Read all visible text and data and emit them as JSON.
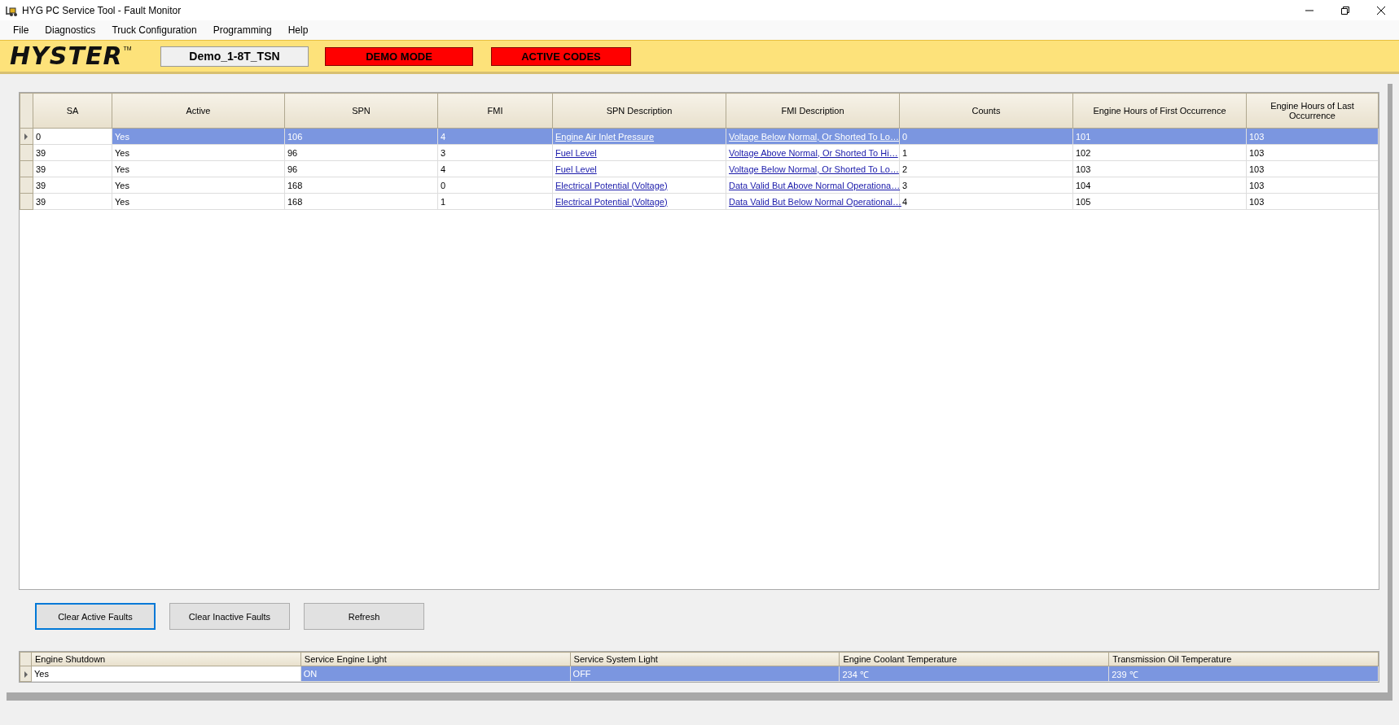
{
  "window": {
    "title": "HYG PC Service Tool - Fault Monitor"
  },
  "menu": [
    {
      "label": "File"
    },
    {
      "label": "Diagnostics"
    },
    {
      "label": "Truck Configuration"
    },
    {
      "label": "Programming"
    },
    {
      "label": "Help"
    }
  ],
  "header": {
    "logo": "HYSTER",
    "trademark": "TM",
    "truck_name": "Demo_1-8T_TSN",
    "indicators": [
      {
        "label": "DEMO MODE",
        "color": "#ff0000"
      },
      {
        "label": "ACTIVE CODES",
        "color": "#ff0000"
      }
    ]
  },
  "fault_table": {
    "columns": [
      "SA",
      "Active",
      "SPN",
      "FMI",
      "SPN Description",
      "FMI Description",
      "Counts",
      "Engine Hours of First Occurrence",
      "Engine Hours of Last Occurrence"
    ],
    "rows": [
      {
        "selected": true,
        "cells": [
          "0",
          "Yes",
          "106",
          "4",
          "Engine Air Inlet Pressure",
          "Voltage Below Normal, Or Shorted To Lo…",
          "0",
          "101",
          "103"
        ]
      },
      {
        "selected": false,
        "cells": [
          "39",
          "Yes",
          "96",
          "3",
          "Fuel Level",
          "Voltage Above Normal, Or Shorted To Hi…",
          "1",
          "102",
          "103"
        ]
      },
      {
        "selected": false,
        "cells": [
          "39",
          "Yes",
          "96",
          "4",
          "Fuel Level",
          "Voltage Below Normal, Or Shorted To Lo…",
          "2",
          "103",
          "103"
        ]
      },
      {
        "selected": false,
        "cells": [
          "39",
          "Yes",
          "168",
          "0",
          "Electrical Potential (Voltage)",
          "Data Valid But Above Normal Operationa…",
          "3",
          "104",
          "103"
        ]
      },
      {
        "selected": false,
        "cells": [
          "39",
          "Yes",
          "168",
          "1",
          "Electrical Potential (Voltage)",
          "Data Valid But Below Normal Operational…",
          "4",
          "105",
          "103"
        ]
      }
    ]
  },
  "buttons": [
    {
      "label": "Clear Active Faults",
      "focused": true
    },
    {
      "label": "Clear Inactive Faults",
      "focused": false
    },
    {
      "label": "Refresh",
      "focused": false
    }
  ],
  "status_table": {
    "columns": [
      "Engine Shutdown",
      "Service Engine Light",
      "Service System Light",
      "Engine Coolant Temperature",
      "Transmission Oil Temperature"
    ],
    "rows": [
      {
        "selected": true,
        "cells": [
          "Yes",
          "ON",
          "OFF",
          "234 ℃",
          "239 ℃"
        ]
      }
    ]
  }
}
